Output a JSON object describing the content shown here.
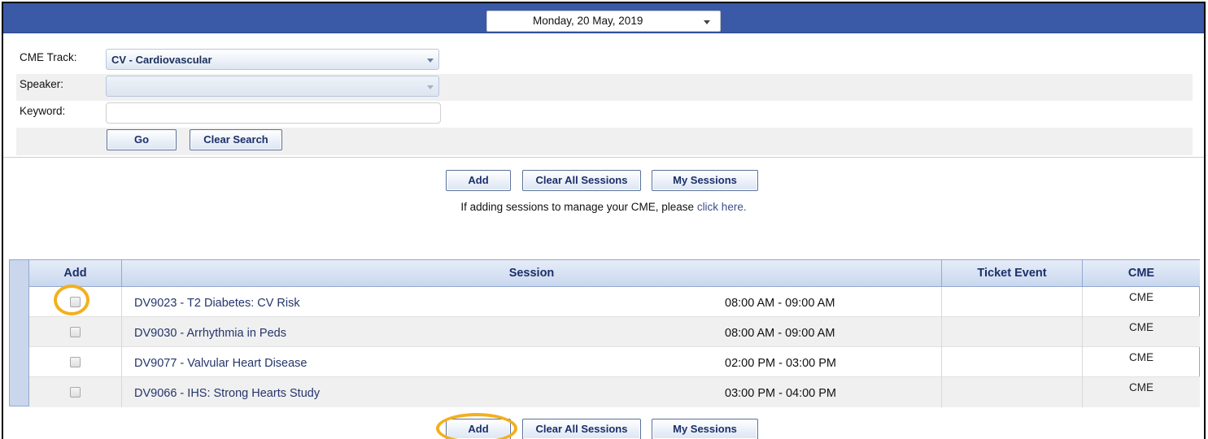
{
  "datebar": {
    "selected_date": "Monday, 20 May, 2019",
    "bg_color": "#3a5aa8"
  },
  "search": {
    "track_label": "CME Track:",
    "track_value": "CV - Cardiovascular",
    "speaker_label": "Speaker:",
    "speaker_value": "",
    "keyword_label": "Keyword:",
    "keyword_value": "",
    "go_label": "Go",
    "clear_search_label": "Clear Search"
  },
  "actions": {
    "add_label": "Add",
    "clear_all_label": "Clear All Sessions",
    "my_sessions_label": "My Sessions",
    "note_text": "If adding sessions to manage your CME, please ",
    "note_link": "click here."
  },
  "table": {
    "headers": {
      "add": "Add",
      "session": "Session",
      "ticket": "Ticket Event",
      "cme": "CME"
    },
    "rows": [
      {
        "title": "DV9023 - T2 Diabetes: CV Risk",
        "time": "08:00 AM - 09:00 AM",
        "ticket": "",
        "cme": "CME",
        "checked": false
      },
      {
        "title": "DV9030 - Arrhythmia in Peds",
        "time": "08:00 AM - 09:00 AM",
        "ticket": "",
        "cme": "CME",
        "checked": false
      },
      {
        "title": "DV9077 - Valvular Heart Disease",
        "time": "02:00 PM - 03:00 PM",
        "ticket": "",
        "cme": "CME",
        "checked": false
      },
      {
        "title": "DV9066 - IHS: Strong Hearts Study",
        "time": "03:00 PM - 04:00 PM",
        "ticket": "",
        "cme": "CME",
        "checked": false
      }
    ]
  },
  "colors": {
    "accent": "#3a5aa8",
    "link": "#24356b",
    "highlight_ring": "#f2b01e"
  }
}
